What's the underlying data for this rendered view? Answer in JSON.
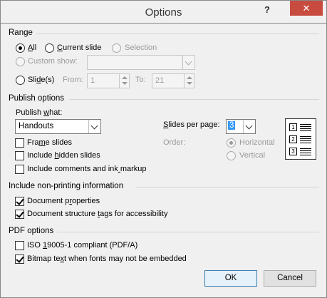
{
  "window": {
    "title": "Options",
    "help": "?",
    "close": "✕"
  },
  "range": {
    "label": "Range",
    "all": "All",
    "current_slide": "Current slide",
    "selection": "Selection",
    "custom_show": "Custom show:",
    "slides": "Slide(s)",
    "from_label": "From:",
    "from_value": "1",
    "to_label": "To:",
    "to_value": "21",
    "selected": "All"
  },
  "publish": {
    "label": "Publish options",
    "publish_what_label": "Publish what:",
    "publish_what_value": "Handouts",
    "frame_slides": "Frame slides",
    "include_hidden": "Include hidden slides",
    "include_comments": "Include comments and ink markup",
    "slides_per_page_label": "Slides per page:",
    "slides_per_page_value": "3",
    "order_label": "Order:",
    "horizontal": "Horizontal",
    "vertical": "Vertical",
    "preview_numbers": [
      "1",
      "2",
      "3"
    ]
  },
  "nonprinting": {
    "label": "Include non-printing information",
    "document_properties": "Document properties",
    "structure_tags": "Document structure tags for accessibility"
  },
  "pdf": {
    "label": "PDF options",
    "iso": "ISO 19005-1 compliant (PDF/A)",
    "bitmap": "Bitmap text when fonts may not be embedded"
  },
  "buttons": {
    "ok": "OK",
    "cancel": "Cancel"
  }
}
